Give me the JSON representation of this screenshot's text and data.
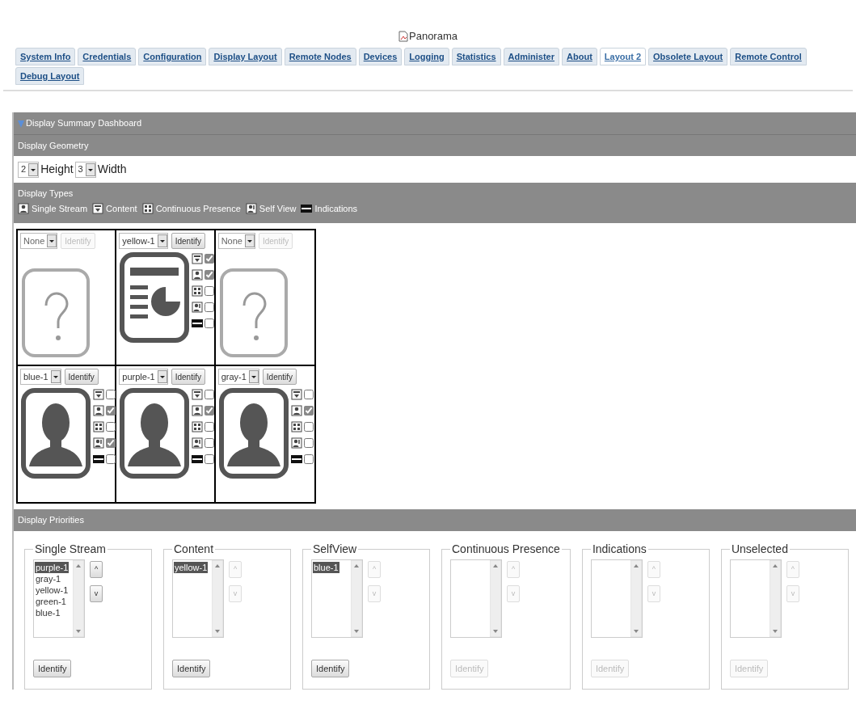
{
  "title": "Panorama",
  "tabs": [
    {
      "label": "System Info",
      "selected": false
    },
    {
      "label": "Credentials",
      "selected": false
    },
    {
      "label": "Configuration",
      "selected": false
    },
    {
      "label": "Display Layout",
      "selected": false
    },
    {
      "label": "Remote Nodes",
      "selected": false
    },
    {
      "label": "Devices",
      "selected": false
    },
    {
      "label": "Logging",
      "selected": false
    },
    {
      "label": "Statistics",
      "selected": false
    },
    {
      "label": "Administer",
      "selected": false
    },
    {
      "label": "About",
      "selected": false
    },
    {
      "label": "Layout 2",
      "selected": true
    },
    {
      "label": "Obsolete Layout",
      "selected": false
    },
    {
      "label": "Remote Control",
      "selected": false
    },
    {
      "label": "Debug Layout",
      "selected": false
    }
  ],
  "dashboard": {
    "title": "Display Summary Dashboard",
    "expanded": true
  },
  "geometry": {
    "title": "Display Geometry",
    "height": {
      "value": "2",
      "label": "Height"
    },
    "width": {
      "value": "3",
      "label": "Width"
    }
  },
  "display_types": {
    "title": "Display Types",
    "legend": [
      {
        "kind": "single",
        "label": "Single Stream"
      },
      {
        "kind": "content",
        "label": "Content"
      },
      {
        "kind": "cp",
        "label": "Continuous Presence"
      },
      {
        "kind": "selfview",
        "label": "Self View"
      },
      {
        "kind": "indications",
        "label": "Indications"
      }
    ]
  },
  "layout_cells": [
    {
      "device": "None",
      "identify": "Identify",
      "disabled": true,
      "kind": "unknown"
    },
    {
      "device": "yellow-1",
      "identify": "Identify",
      "disabled": false,
      "kind": "content",
      "options": [
        {
          "kind": "content",
          "checked": true
        },
        {
          "kind": "single",
          "checked": true
        },
        {
          "kind": "cp",
          "checked": false
        },
        {
          "kind": "selfview",
          "checked": false
        },
        {
          "kind": "indications",
          "checked": false
        }
      ]
    },
    {
      "device": "None",
      "identify": "Identify",
      "disabled": true,
      "kind": "unknown"
    },
    {
      "device": "blue-1",
      "identify": "Identify",
      "disabled": false,
      "kind": "person",
      "options": [
        {
          "kind": "content",
          "checked": false
        },
        {
          "kind": "single",
          "checked": true
        },
        {
          "kind": "cp",
          "checked": false
        },
        {
          "kind": "selfview",
          "checked": true
        },
        {
          "kind": "indications",
          "checked": false
        }
      ]
    },
    {
      "device": "purple-1",
      "identify": "Identify",
      "disabled": false,
      "kind": "person",
      "options": [
        {
          "kind": "content",
          "checked": false
        },
        {
          "kind": "single",
          "checked": true
        },
        {
          "kind": "cp",
          "checked": false
        },
        {
          "kind": "selfview",
          "checked": false
        },
        {
          "kind": "indications",
          "checked": false
        }
      ]
    },
    {
      "device": "gray-1",
      "identify": "Identify",
      "disabled": false,
      "kind": "person",
      "options": [
        {
          "kind": "content",
          "checked": false
        },
        {
          "kind": "single",
          "checked": true
        },
        {
          "kind": "cp",
          "checked": false
        },
        {
          "kind": "selfview",
          "checked": false
        },
        {
          "kind": "indications",
          "checked": false
        }
      ]
    }
  ],
  "priorities": {
    "title": "Display Priorities",
    "groups": [
      {
        "title": "Single Stream",
        "items": [
          {
            "label": "purple-1",
            "selected": true
          },
          {
            "label": "gray-1",
            "selected": false
          },
          {
            "label": "yellow-1",
            "selected": false
          },
          {
            "label": "green-1",
            "selected": false
          },
          {
            "label": "blue-1",
            "selected": false
          }
        ],
        "up": "^",
        "down": "v",
        "move_disabled": false,
        "identify": "Identify",
        "identify_disabled": false
      },
      {
        "title": "Content",
        "items": [
          {
            "label": "yellow-1",
            "selected": true
          }
        ],
        "up": "^",
        "down": "v",
        "move_disabled": true,
        "identify": "Identify",
        "identify_disabled": false
      },
      {
        "title": "SelfView",
        "items": [
          {
            "label": "blue-1",
            "selected": true
          }
        ],
        "up": "^",
        "down": "v",
        "move_disabled": true,
        "identify": "Identify",
        "identify_disabled": false
      },
      {
        "title": "Continuous Presence",
        "up": "^",
        "down": "v",
        "move_disabled": true,
        "identify": "Identify",
        "identify_disabled": true
      },
      {
        "title": "Indications",
        "up": "^",
        "down": "v",
        "move_disabled": true,
        "identify": "Identify",
        "identify_disabled": true
      },
      {
        "title": "Unselected",
        "up": "^",
        "down": "v",
        "move_disabled": true,
        "identify": "Identify",
        "identify_disabled": true
      }
    ]
  }
}
